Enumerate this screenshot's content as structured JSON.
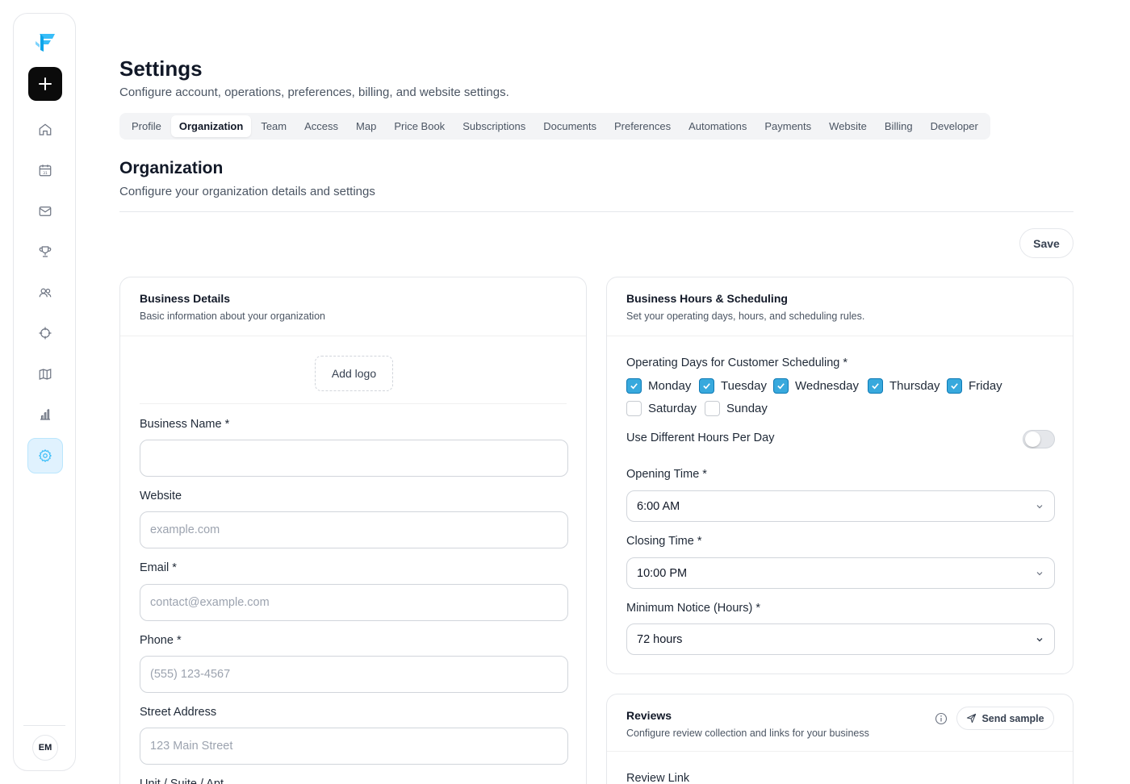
{
  "sidebar": {
    "items": [
      {
        "icon": "home-icon"
      },
      {
        "icon": "calendar-icon"
      },
      {
        "icon": "mail-icon"
      },
      {
        "icon": "trophy-icon"
      },
      {
        "icon": "users-icon"
      },
      {
        "icon": "crosshair-icon"
      },
      {
        "icon": "map-icon"
      },
      {
        "icon": "bar-chart-icon"
      },
      {
        "icon": "gear-icon"
      }
    ],
    "avatar": "EM",
    "accent": "#38bdf8"
  },
  "header": {
    "title": "Settings",
    "subtitle": "Configure account, operations, preferences, billing, and website settings."
  },
  "tabs": [
    {
      "label": "Profile"
    },
    {
      "label": "Organization"
    },
    {
      "label": "Team"
    },
    {
      "label": "Access"
    },
    {
      "label": "Map"
    },
    {
      "label": "Price Book"
    },
    {
      "label": "Subscriptions"
    },
    {
      "label": "Documents"
    },
    {
      "label": "Preferences"
    },
    {
      "label": "Automations"
    },
    {
      "label": "Payments"
    },
    {
      "label": "Website"
    },
    {
      "label": "Billing"
    },
    {
      "label": "Developer"
    }
  ],
  "active_tab": "Organization",
  "section": {
    "title": "Organization",
    "subtitle": "Configure your organization details and settings",
    "save_label": "Save"
  },
  "business_details": {
    "title": "Business Details",
    "description": "Basic information about your organization",
    "add_logo": "Add logo",
    "business_name": {
      "label": "Business Name *",
      "value": "",
      "placeholder": ""
    },
    "website": {
      "label": "Website",
      "value": "",
      "placeholder": "example.com"
    },
    "email": {
      "label": "Email *",
      "value": "",
      "placeholder": "contact@example.com"
    },
    "phone": {
      "label": "Phone *",
      "value": "",
      "placeholder": "(555) 123-4567"
    },
    "street": {
      "label": "Street Address",
      "value": "",
      "placeholder": "123 Main Street"
    },
    "unit": {
      "label": "Unit / Suite / Apt"
    }
  },
  "hours": {
    "title": "Business Hours & Scheduling",
    "description": "Set your operating days, hours, and scheduling rules.",
    "days_label": "Operating Days for Customer Scheduling *",
    "days": [
      {
        "label": "Monday",
        "checked": true
      },
      {
        "label": "Tuesday",
        "checked": true
      },
      {
        "label": "Wednesday",
        "checked": true
      },
      {
        "label": "Thursday",
        "checked": true
      },
      {
        "label": "Friday",
        "checked": true
      },
      {
        "label": "Saturday",
        "checked": false
      },
      {
        "label": "Sunday",
        "checked": false
      }
    ],
    "different_hours_label": "Use Different Hours Per Day",
    "different_hours_enabled": false,
    "opening": {
      "label": "Opening Time *",
      "value": "6:00 AM"
    },
    "closing": {
      "label": "Closing Time *",
      "value": "10:00 PM"
    },
    "notice": {
      "label": "Minimum Notice (Hours) *",
      "value": "72 hours"
    }
  },
  "reviews": {
    "title": "Reviews",
    "description": "Configure review collection and links for your business",
    "send_sample": "Send sample",
    "review_link_label": "Review Link"
  }
}
